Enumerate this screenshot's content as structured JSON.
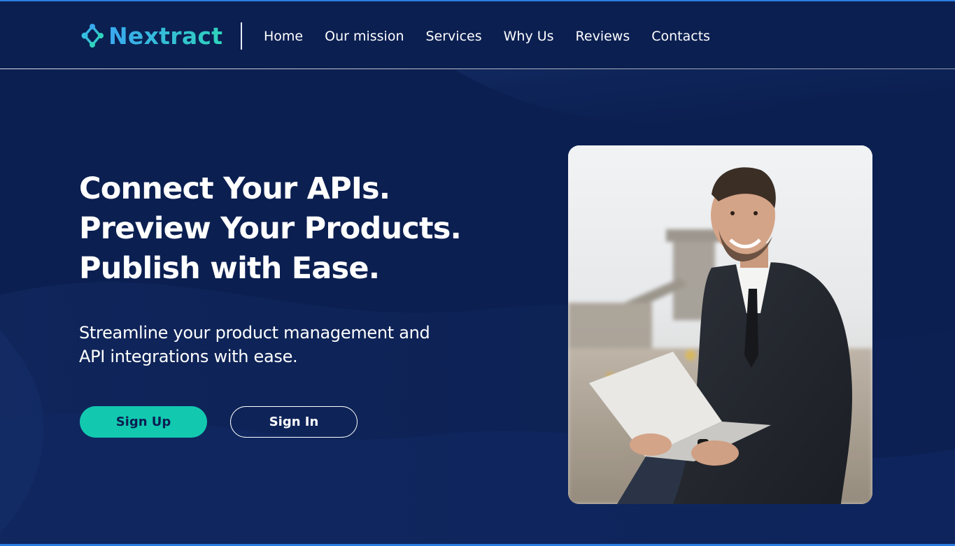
{
  "brand": {
    "name": "Nextract",
    "logo_icon": "network-nodes-icon",
    "gradient_start": "#3aa9f0",
    "gradient_end": "#2fd3bd"
  },
  "nav": {
    "items": [
      {
        "label": "Home"
      },
      {
        "label": "Our mission"
      },
      {
        "label": "Services"
      },
      {
        "label": "Why Us"
      },
      {
        "label": "Reviews"
      },
      {
        "label": "Contacts"
      }
    ]
  },
  "hero": {
    "headline": [
      "Connect Your APIs.",
      "Preview Your Products.",
      "Publish with Ease."
    ],
    "subtext": "Streamline your product management and API integrations with ease.",
    "primary_button": "Sign Up",
    "secondary_button": "Sign In",
    "image": "businessman-with-laptop-photo"
  },
  "colors": {
    "background": "#0b1f51",
    "accent": "#12c9b0",
    "text": "#ffffff"
  }
}
